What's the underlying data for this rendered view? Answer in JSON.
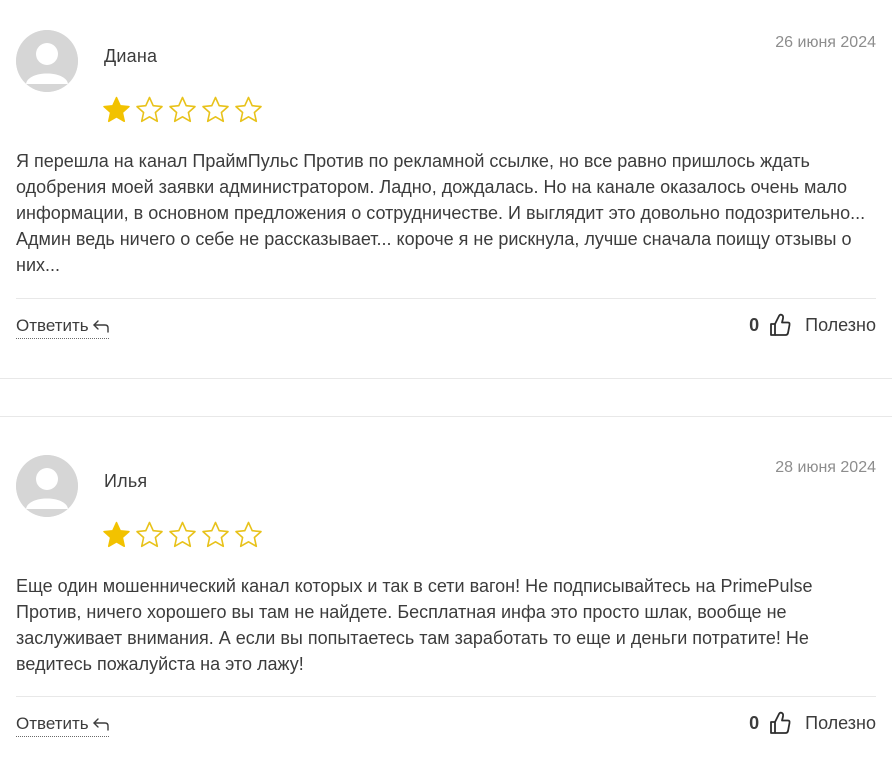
{
  "reviews": [
    {
      "author": "Диана",
      "date": "26 июня 2024",
      "rating": 1,
      "max_rating": 5,
      "text": "Я перешла на канал ПраймПульс Против по рекламной ссылке, но все равно пришлось ждать одобрения моей заявки администратором. Ладно, дождалась. Но на канале оказалось очень мало информации, в основном предложения о сотрудничестве. И выглядит это довольно подозрительно... Админ ведь ничего о себе не рассказывает... короче я не рискнула, лучше сначала поищу отзывы о них...",
      "reply_label": "Ответить",
      "likes": "0",
      "useful_label": "Полезно"
    },
    {
      "author": "Илья",
      "date": "28 июня 2024",
      "rating": 1,
      "max_rating": 5,
      "text": "Еще один мошеннический канал которых и так в сети вагон! Не подписывайтесь на PrimePulse Против, ничего хорошего вы там не найдете. Бесплатная инфа это просто шлак, вообще не заслуживает внимания. А если вы попытаетесь там заработать то еще и деньги потратите! Не ведитесь пожалуйста на это лажу!",
      "reply_label": "Ответить",
      "likes": "0",
      "useful_label": "Полезно"
    }
  ],
  "colors": {
    "star_filled": "#f2c200",
    "star_outline": "#e8c21a",
    "text": "#3c3c3c",
    "date": "#8d8d8d",
    "divider": "#e8e8e8",
    "avatar_bg": "#d8d8d8"
  },
  "icons": {
    "avatar": "user-silhouette-icon",
    "reply": "reply-arrow-icon",
    "like": "thumbs-up-icon",
    "star": "star-icon"
  }
}
